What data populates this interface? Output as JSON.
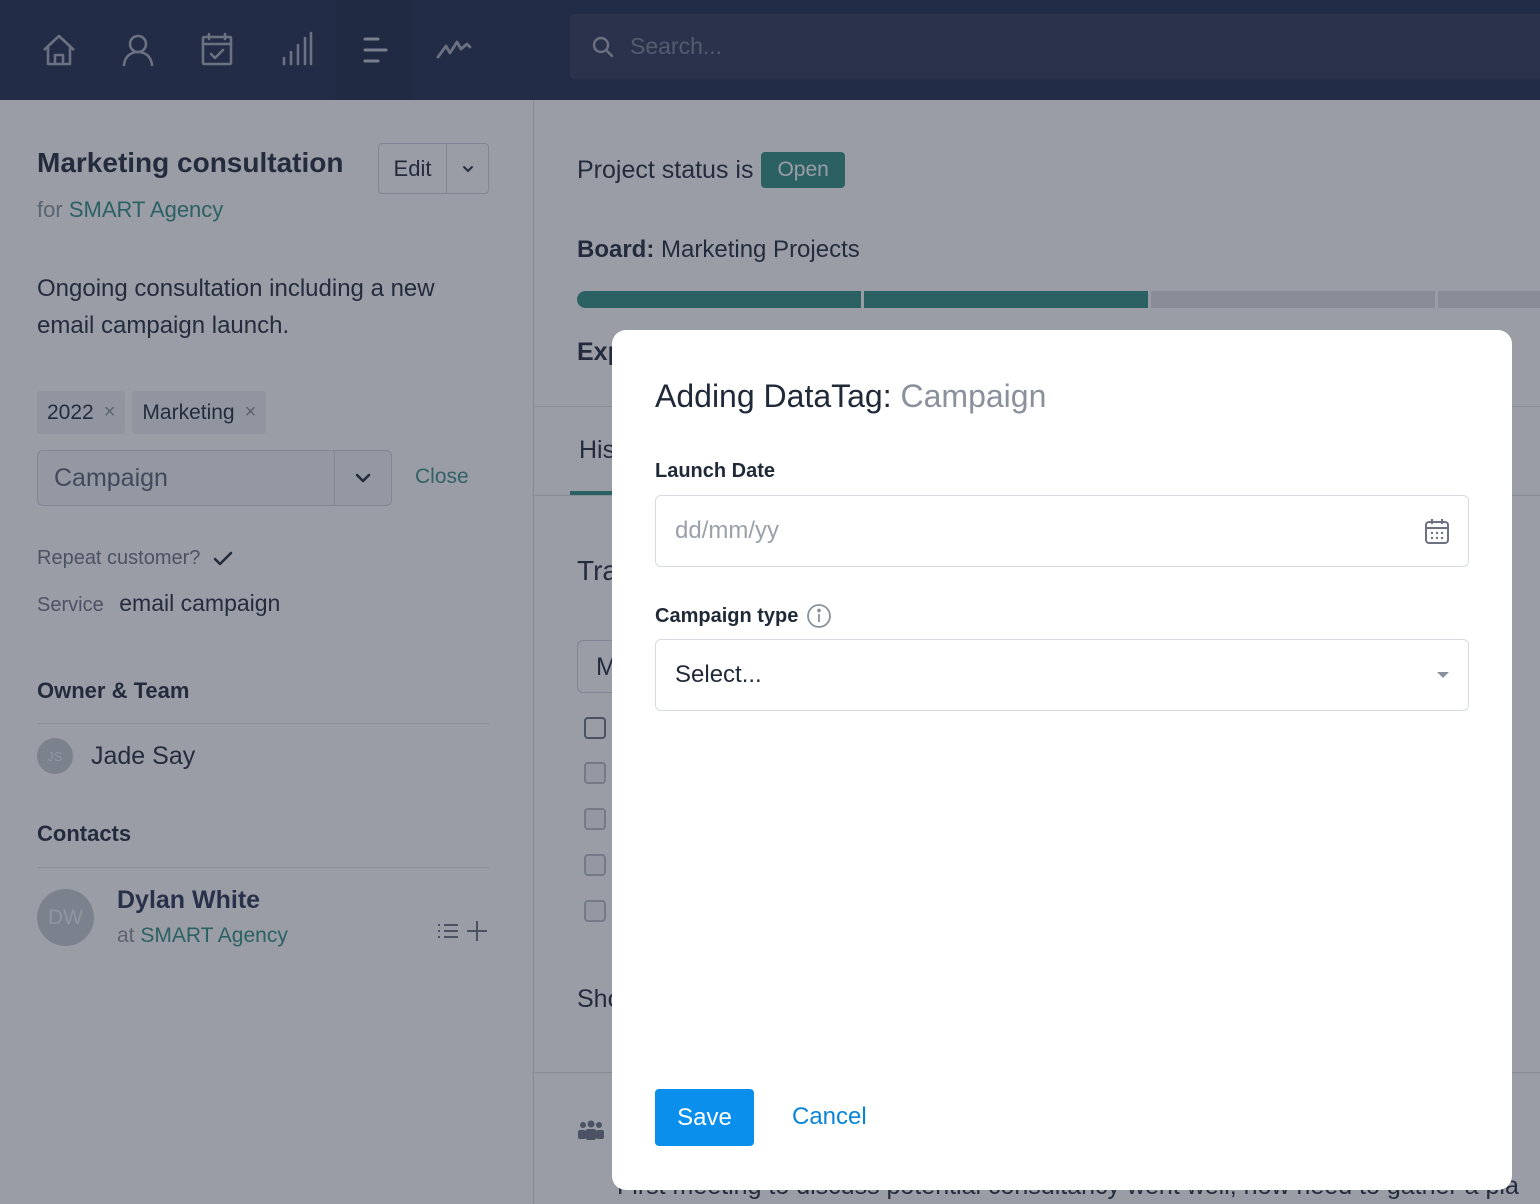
{
  "topbar": {
    "nav_items": [
      {
        "icon": "home-icon",
        "active": false
      },
      {
        "icon": "user-icon",
        "active": false
      },
      {
        "icon": "calendar-check-icon",
        "active": false
      },
      {
        "icon": "signal-bars-icon",
        "active": false
      },
      {
        "icon": "menu-lines-icon",
        "active": true
      },
      {
        "icon": "activity-line-icon",
        "active": false
      }
    ],
    "search_placeholder": "Search..."
  },
  "project": {
    "title": "Marketing consultation",
    "edit_label": "Edit",
    "for_prefix": "for",
    "client": "SMART Agency",
    "description": "Ongoing consultation including a new email campaign launch.",
    "tags": [
      "2022",
      "Marketing"
    ],
    "tag_remove_glyph": "×",
    "datatag_select_value": "Campaign",
    "close_label": "Close",
    "repeat_customer_label": "Repeat customer?",
    "repeat_customer_value": true,
    "service_label": "Service",
    "service_value": "email campaign",
    "owner_section": "Owner & Team",
    "owner": {
      "initials": "JS",
      "name": "Jade Say"
    },
    "contacts_section": "Contacts",
    "contacts": [
      {
        "initials": "DW",
        "name": "Dylan White",
        "at_prefix": "at",
        "company": "SMART Agency"
      }
    ]
  },
  "main": {
    "status_prefix": "Project status is",
    "status": "Open",
    "board_label": "Board:",
    "board_name": "Marketing Projects",
    "stages_completed": 2,
    "stages_total": 4,
    "partial_texts": {
      "exp": "Exp",
      "his": "His",
      "tra": "Tra",
      "m": "M",
      "sho": "Sho",
      "note": "First meeting to discuss potential consultancy went well, now need to gather a pla"
    },
    "checkbox_count": 5
  },
  "modal": {
    "title_prefix": "Adding DataTag:",
    "title_tag": "Campaign",
    "fields": [
      {
        "label": "Launch Date",
        "placeholder": "dd/mm/yy",
        "icon": "calendar-icon"
      },
      {
        "label": "Campaign type",
        "value": "Select...",
        "info_icon": true,
        "icon": "dropdown-caret-icon"
      }
    ],
    "save_label": "Save",
    "cancel_label": "Cancel"
  },
  "colors": {
    "nav_bg": "#1e2a4a",
    "accent_teal": "#2f8f80",
    "primary_blue": "#0a90ec"
  }
}
